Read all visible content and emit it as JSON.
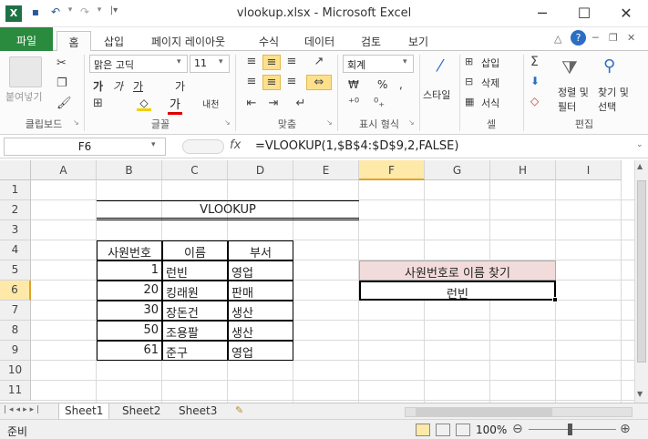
{
  "window": {
    "title": "vlookup.xlsx  -  Microsoft Excel"
  },
  "quick_access": {
    "save": "save-icon",
    "undo": "undo-icon",
    "redo": "redo-icon"
  },
  "tabs": [
    {
      "label": "파일"
    },
    {
      "label": "홈"
    },
    {
      "label": "삽입"
    },
    {
      "label": "페이지 레이아웃"
    },
    {
      "label": "수식"
    },
    {
      "label": "데이터"
    },
    {
      "label": "검토"
    },
    {
      "label": "보기"
    }
  ],
  "ribbon": {
    "clipboard": {
      "paste": "붙여넣기",
      "label": "클립보드"
    },
    "font": {
      "name": "맑은 고딕",
      "size": "11",
      "bold": "가",
      "italic": "가",
      "underline": "가",
      "grow": "가",
      "label": "글꼴",
      "phonetic": "내천"
    },
    "align": {
      "label": "맞춤"
    },
    "number": {
      "format": "회계",
      "label": "표시 형식",
      "currency": "₩",
      "percent": "%",
      "comma": ","
    },
    "styles": {
      "label": "스타일"
    },
    "cells": {
      "insert": "삽입",
      "delete": "삭제",
      "format": "서식",
      "label": "셀"
    },
    "editing": {
      "sort": "정렬 및 필터",
      "find": "찾기 및 선택",
      "label": "편집"
    }
  },
  "formula_bar": {
    "name_box": "F6",
    "fx": "fx",
    "formula": "=VLOOKUP(1,$B$4:$D$9,2,FALSE)"
  },
  "columns": [
    "A",
    "B",
    "C",
    "D",
    "E",
    "F",
    "G",
    "H",
    "I"
  ],
  "rows": [
    "1",
    "2",
    "3",
    "4",
    "5",
    "6",
    "7",
    "8",
    "9",
    "10",
    "11"
  ],
  "sheet": {
    "title": "VLOOKUP",
    "table_headers": [
      "사원번호",
      "이름",
      "부서"
    ],
    "table_rows": [
      [
        "1",
        "런빈",
        "영업"
      ],
      [
        "20",
        "킹래원",
        "판매"
      ],
      [
        "30",
        "장돈건",
        "생산"
      ],
      [
        "50",
        "조용팔",
        "생산"
      ],
      [
        "61",
        "준구",
        "영업"
      ]
    ],
    "lookup_label": "사원번호로 이름 찾기",
    "lookup_result": "런빈"
  },
  "sheet_tabs": [
    "Sheet1",
    "Sheet2",
    "Sheet3"
  ],
  "status": {
    "mode": "준비",
    "zoom": "100%"
  },
  "colors": {
    "file_tab": "#2a8a3e",
    "selection": "#ffe9a8",
    "lookup_fill": "#f2dcdb"
  }
}
